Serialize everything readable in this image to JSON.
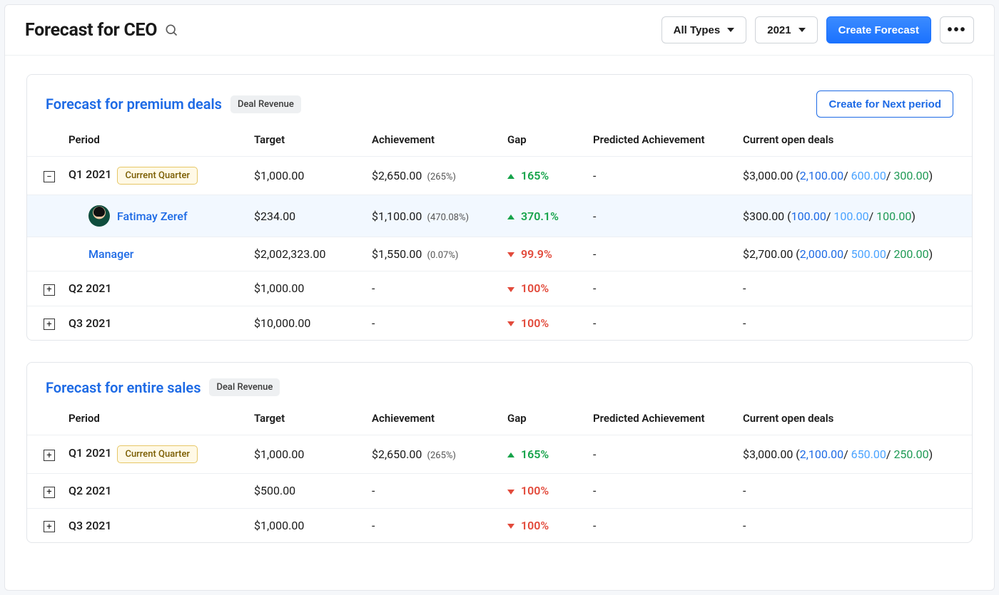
{
  "header": {
    "title": "Forecast for CEO",
    "type_filter": "All Types",
    "year_filter": "2021",
    "create_button": "Create Forecast"
  },
  "columns": {
    "period": "Period",
    "target": "Target",
    "achievement": "Achievement",
    "gap": "Gap",
    "predicted": "Predicted Achievement",
    "open": "Current open deals"
  },
  "badges": {
    "current_quarter": "Current Quarter"
  },
  "cards": [
    {
      "title": "Forecast for premium deals",
      "tag": "Deal Revenue",
      "action": "Create for Next period",
      "rows": [
        {
          "toggle": "minus",
          "period": "Q1 2021",
          "current": true,
          "target": "$1,000.00",
          "achievement": "$2,650.00",
          "achievement_pct": "(265%)",
          "gap_dir": "up",
          "gap": "165%",
          "predicted": "-",
          "open_total": "$3,000.00",
          "open_a": "2,100.00",
          "open_b": "600.00",
          "open_c": "300.00",
          "children": [
            {
              "highlight": true,
              "avatar": true,
              "name": "Fatimay Zeref",
              "target": "$234.00",
              "achievement": "$1,100.00",
              "achievement_pct": "(470.08%)",
              "gap_dir": "up",
              "gap": "370.1%",
              "predicted": "-",
              "open_total": "$300.00",
              "open_a": "100.00",
              "open_b": "100.00",
              "open_c": "100.00"
            },
            {
              "name": "Manager",
              "target": "$2,002,323.00",
              "achievement": "$1,550.00",
              "achievement_pct": "(0.07%)",
              "gap_dir": "down",
              "gap": "99.9%",
              "predicted": "-",
              "open_total": "$2,700.00",
              "open_a": "2,000.00",
              "open_b": "500.00",
              "open_c": "200.00"
            }
          ]
        },
        {
          "toggle": "plus",
          "period": "Q2 2021",
          "target": "$1,000.00",
          "achievement": "-",
          "gap_dir": "down",
          "gap": "100%",
          "predicted": "-",
          "open_total": "-"
        },
        {
          "toggle": "plus",
          "period": "Q3 2021",
          "target": "$10,000.00",
          "achievement": "-",
          "gap_dir": "down",
          "gap": "100%",
          "predicted": "-",
          "open_total": "-"
        }
      ]
    },
    {
      "title": "Forecast for entire sales",
      "tag": "Deal Revenue",
      "rows": [
        {
          "toggle": "plus",
          "period": "Q1 2021",
          "current": true,
          "target": "$1,000.00",
          "achievement": "$2,650.00",
          "achievement_pct": "(265%)",
          "gap_dir": "up",
          "gap": "165%",
          "predicted": "-",
          "open_total": "$3,000.00",
          "open_a": "2,100.00",
          "open_b": "650.00",
          "open_c": "250.00"
        },
        {
          "toggle": "plus",
          "period": "Q2 2021",
          "target": "$500.00",
          "achievement": "-",
          "gap_dir": "down",
          "gap": "100%",
          "predicted": "-",
          "open_total": "-"
        },
        {
          "toggle": "plus",
          "period": "Q3 2021",
          "target": "$1,000.00",
          "achievement": "-",
          "gap_dir": "down",
          "gap": "100%",
          "predicted": "-",
          "open_total": "-"
        }
      ]
    }
  ]
}
